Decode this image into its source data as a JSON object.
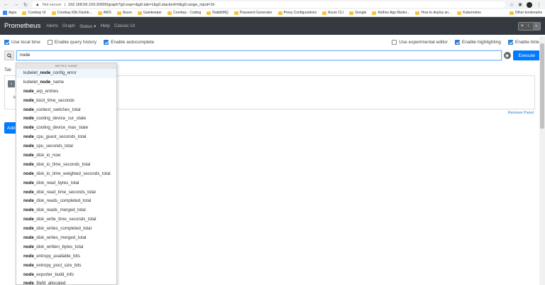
{
  "browser": {
    "not_secure": "Not secure",
    "url": "192.168.56.103:30000/graph?g0.expr=&g0.tab=1&g0.stacked=0&g0.range_input=1h"
  },
  "bookmarks": {
    "items": [
      "Apps",
      "Corebay UI",
      "Corebay K8s Dashb...",
      "AWS",
      "Azure",
      "Gatekeeper",
      "Corebay - Coding",
      "RabbitMQ",
      "Password Generator",
      "Proxy Configurations",
      "Azure CLI",
      "Google",
      "Anthos App Moder...",
      "How to deploy an...",
      "Kubernetes"
    ],
    "other": "Other bookmarks"
  },
  "navbar": {
    "brand": "Prometheus",
    "links": [
      "Alerts",
      "Graph",
      "Status ▾",
      "Help",
      "Classic UI"
    ]
  },
  "options": {
    "local_time": "Use local time",
    "query_history": "Enable query history",
    "autocomplete": "Enable autocomplete",
    "experimental_editor": "Use experimental editor",
    "highlighting": "Enable highlighting",
    "linter": "Enable linter"
  },
  "query": {
    "value": "node",
    "execute": "Execute"
  },
  "panel": {
    "tab_stub": "Tab",
    "n_stub": "N",
    "remove": "Remove Panel",
    "add": "Add"
  },
  "dropdown": {
    "header": "METRIC NAME",
    "match": "node",
    "items": [
      {
        "pre": "kubelet_",
        "match": "node",
        "post": "_config_error"
      },
      {
        "pre": "kubelet_",
        "match": "node",
        "post": "_name"
      },
      {
        "pre": "",
        "match": "node",
        "post": "_arp_entries"
      },
      {
        "pre": "",
        "match": "node",
        "post": "_boot_time_seconds"
      },
      {
        "pre": "",
        "match": "node",
        "post": "_context_switches_total"
      },
      {
        "pre": "",
        "match": "node",
        "post": "_cooling_device_cur_state"
      },
      {
        "pre": "",
        "match": "node",
        "post": "_cooling_device_max_state"
      },
      {
        "pre": "",
        "match": "node",
        "post": "_cpu_guest_seconds_total"
      },
      {
        "pre": "",
        "match": "node",
        "post": "_cpu_seconds_total"
      },
      {
        "pre": "",
        "match": "node",
        "post": "_disk_io_now"
      },
      {
        "pre": "",
        "match": "node",
        "post": "_disk_io_time_seconds_total"
      },
      {
        "pre": "",
        "match": "node",
        "post": "_disk_io_time_weighted_seconds_total"
      },
      {
        "pre": "",
        "match": "node",
        "post": "_disk_read_bytes_total"
      },
      {
        "pre": "",
        "match": "node",
        "post": "_disk_read_time_seconds_total"
      },
      {
        "pre": "",
        "match": "node",
        "post": "_disk_reads_completed_total"
      },
      {
        "pre": "",
        "match": "node",
        "post": "_disk_reads_merged_total"
      },
      {
        "pre": "",
        "match": "node",
        "post": "_disk_write_time_seconds_total"
      },
      {
        "pre": "",
        "match": "node",
        "post": "_disk_writes_completed_total"
      },
      {
        "pre": "",
        "match": "node",
        "post": "_disk_writes_merged_total"
      },
      {
        "pre": "",
        "match": "node",
        "post": "_disk_written_bytes_total"
      },
      {
        "pre": "",
        "match": "node",
        "post": "_entropy_available_bits"
      },
      {
        "pre": "",
        "match": "node",
        "post": "_entropy_pool_size_bits"
      },
      {
        "pre": "",
        "match": "node",
        "post": "_exporter_build_info"
      },
      {
        "pre": "",
        "match": "node",
        "post": "_filefd_allocated"
      }
    ]
  }
}
